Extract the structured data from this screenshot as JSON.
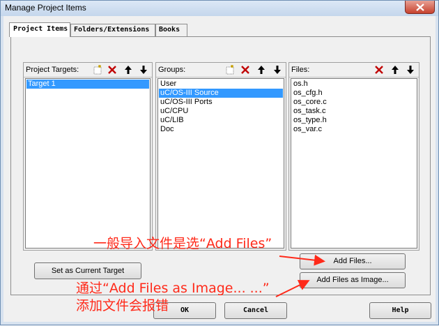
{
  "window": {
    "title": "Manage Project Items"
  },
  "tabs": [
    {
      "label": "Project Items",
      "active": true
    },
    {
      "label": "Folders/Extensions",
      "active": false
    },
    {
      "label": "Books",
      "active": false
    }
  ],
  "targets": {
    "label": "Project Targets:",
    "items": [
      "Target 1"
    ],
    "selected_index": 0
  },
  "groups": {
    "label": "Groups:",
    "items": [
      "User",
      "uC/OS-III Source",
      "uC/OS-III Ports",
      "uC/CPU",
      "uC/LIB",
      "Doc"
    ],
    "selected_index": 1
  },
  "files": {
    "label": "Files:",
    "items": [
      "os.h",
      "os_cfg.h",
      "os_core.c",
      "os_task.c",
      "os_type.h",
      "os_var.c"
    ]
  },
  "buttons": {
    "set_current_target": "Set as Current Target",
    "add_files": "Add Files...",
    "add_files_as_image": "Add Files as Image...",
    "ok": "OK",
    "cancel": "Cancel",
    "help": "Help"
  },
  "annotations": {
    "add_files_note": "一般导入文件是选“Add Files”",
    "image_note_line1": "通过“Add Files as Image... ...”",
    "image_note_line2": "添加文件会报错",
    "color": "#ff2a1a"
  },
  "icons": {
    "new": "new-item-icon",
    "delete": "delete-icon",
    "up": "move-up-icon",
    "down": "move-down-icon",
    "close": "close-icon"
  }
}
